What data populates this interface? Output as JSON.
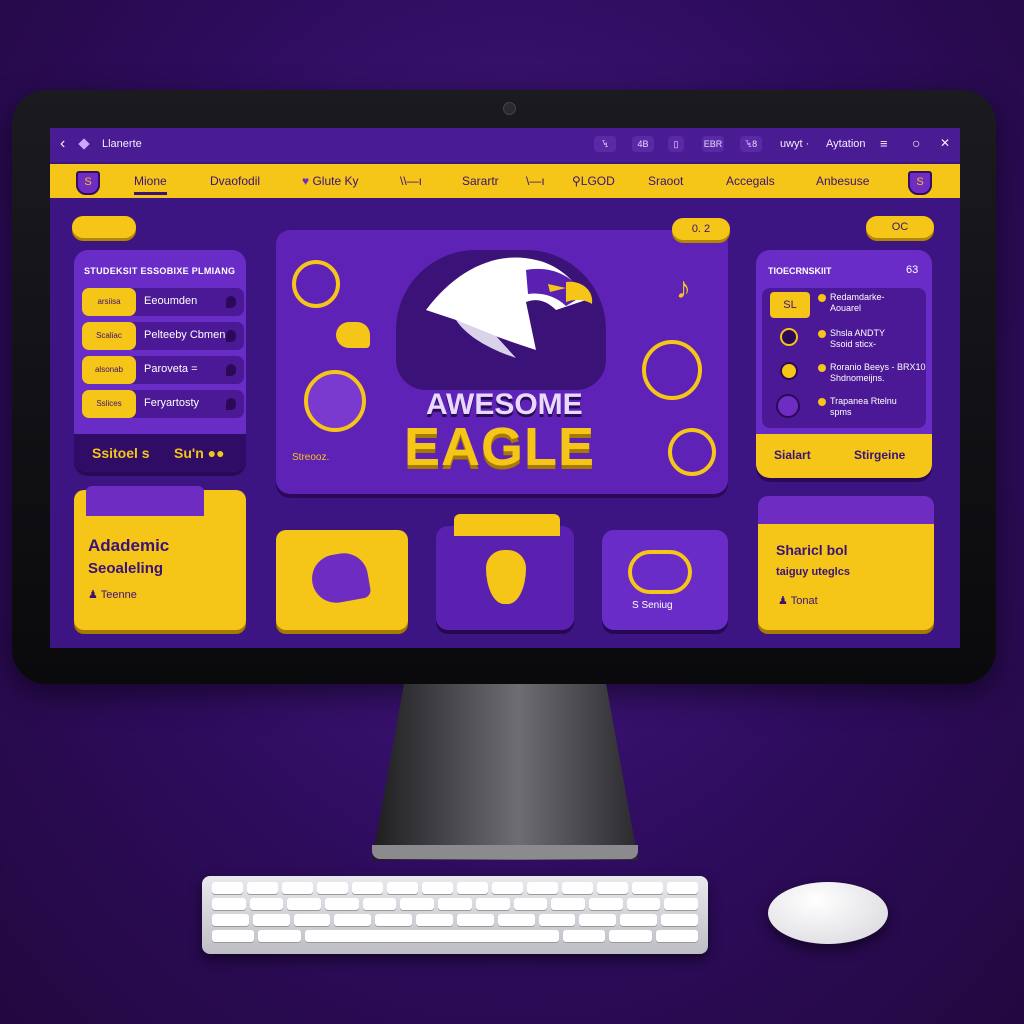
{
  "titlebar": {
    "back_glyph": "‹",
    "title": "Llanerte",
    "buttons": [
      "ꔃ",
      "4B",
      "▯",
      "EBR",
      "ꔃ8"
    ],
    "user": "uwyt ·",
    "app": "Aytation",
    "menu_glyph": "≡",
    "circle_glyph": "○",
    "close_glyph": "✕"
  },
  "nav": {
    "items": [
      "Mione",
      "Dvaofodil",
      "Glute Ky",
      "\\\\—ı",
      "Sarartr",
      "\\—ı",
      "LGOD",
      "Sraoot",
      "Accegals",
      "Anbesuse"
    ]
  },
  "left_pill": "     ",
  "left_panel": {
    "title": "STUDEKSIT ESSOBIXE PLMIANG",
    "rows": [
      {
        "tag": "arsiisa",
        "label": "Eeoumden"
      },
      {
        "tag": "Scaliac",
        "label": "Pelteeby Cbmen"
      },
      {
        "tag": "alsonab",
        "label": "Paroveta ="
      },
      {
        "tag": "Sslices",
        "label": "Feryartosty"
      }
    ],
    "footer_left": "Ssitoel s",
    "footer_right": "Su'n ●●"
  },
  "hero": {
    "line1": "AWESOME",
    "line2": "EAGLE",
    "small": "Streooz."
  },
  "top_right_pill1": "0.  2",
  "top_right_pill2": "OC",
  "right_panel": {
    "title": "TIOECRNSKIIT",
    "count": "63",
    "badge": "SL",
    "items": [
      {
        "line1": "Redamdarke-",
        "line2": "Aouarel"
      },
      {
        "line1": "Shsla ANDTY",
        "line2": "Ssoid sticx-"
      },
      {
        "line1": "Roranio Beeys - BRX10",
        "line2": "Shdnomeijns."
      },
      {
        "line1": "Trapanea Rtelnu",
        "line2": "spms"
      }
    ],
    "footer_left": "Sialart",
    "footer_right": "Stirgeine"
  },
  "bottom": {
    "academic_line1": "Adademic",
    "academic_line2": "Seoaleling",
    "academic_small": "Teenne",
    "seniug": "S Seniug",
    "right_line1": "Sharicl bol",
    "right_line2": "taiguy uteglcs",
    "right_small": "Tonat"
  },
  "colors": {
    "purple": "#3d1582",
    "yellow": "#f5c518"
  }
}
